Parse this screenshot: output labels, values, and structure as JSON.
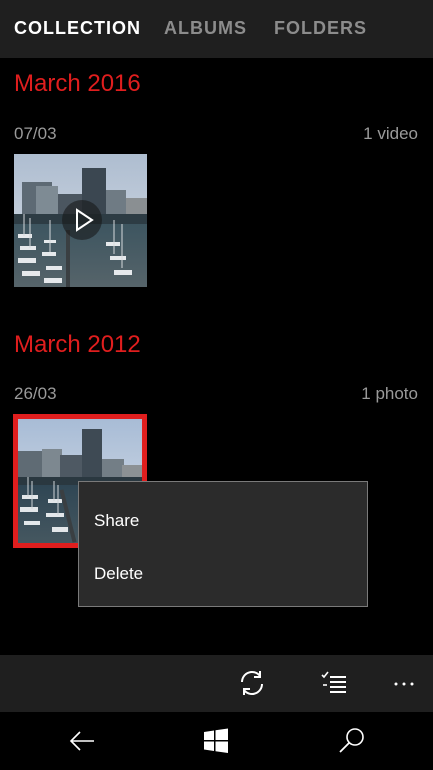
{
  "tabs": [
    {
      "label": "COLLECTION",
      "active": true
    },
    {
      "label": "ALBUMS",
      "active": false
    },
    {
      "label": "FOLDERS",
      "active": false
    }
  ],
  "groups": [
    {
      "month": "March 2016",
      "date": "07/03",
      "count": "1 video",
      "item_type": "video"
    },
    {
      "month": "March 2012",
      "date": "26/03",
      "count": "1 photo",
      "item_type": "photo",
      "selected": true
    }
  ],
  "context_menu": {
    "items": [
      "Share",
      "Delete"
    ]
  },
  "app_bar": {
    "buttons": [
      "sync-icon",
      "select-icon",
      "more-icon"
    ]
  },
  "nav_bar": {
    "buttons": [
      "back-icon",
      "windows-start-icon",
      "search-icon"
    ]
  },
  "colors": {
    "accent": "#e01e1e",
    "bar": "#1f1f1f",
    "menu_bg": "#2b2b2b",
    "menu_border": "#7a7a7a"
  }
}
